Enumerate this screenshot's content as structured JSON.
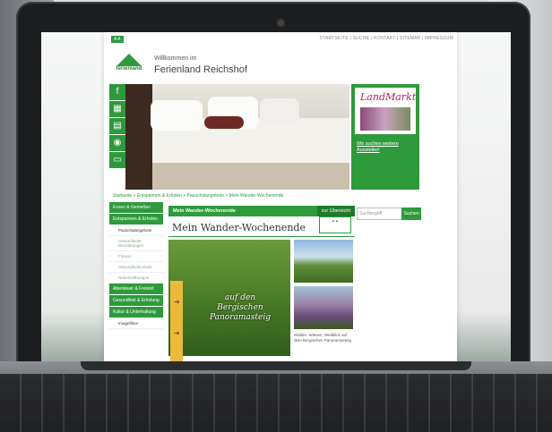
{
  "toplinks": {
    "fontsize_label": "A A",
    "links": "STARTSEITE | SUCHE | KONTAKT | SITEMAP | IMPRESSUM"
  },
  "header": {
    "logo_text": "ferienland",
    "welcome": "Willkommen im",
    "title": "Ferienland Reichshof"
  },
  "side_icons": [
    "facebook-icon",
    "calendar-icon",
    "document-icon",
    "camera-icon",
    "monitor-icon"
  ],
  "ad": {
    "title": "LandMarkt",
    "link": "Wir suchen weitere Aussteller!"
  },
  "breadcrumb": "Startseite > Entspannen & Erholen > Pauschalangebote > Mein Wander-Wochenende",
  "leftnav": {
    "main1": "Essen & Genießen",
    "main2": "Entspannen & Erholen",
    "sub1": "Pauschalangebote",
    "sub2": "Gesundheits- Wanderungen",
    "sub3": "Fitness",
    "sub4": "Gesundheitsurlaub",
    "sub5": "Naturheiltherapie",
    "main3": "Abenteuer & Freizeit",
    "main4": "Gesundheit & Erholung",
    "main5": "Kultur & Unterhaltung",
    "sub6": "Imagefilme"
  },
  "content": {
    "bar_title": "Mein Wander-Wochenende",
    "back_link": "zur Übersicht",
    "title": "Mein Wander-Wochenende",
    "script_line1": "auf den",
    "script_line2": "Bergischen",
    "script_line3": "Panoramasteig",
    "thumb_caption": "Wälder, Wiesen, Weitblick auf dem Bergischen Panoramasteig"
  },
  "search": {
    "placeholder": "Suchbegriff",
    "button": "Suchen"
  },
  "colors": {
    "brand_green": "#2e9a3c",
    "accent_pink": "#b3245e"
  }
}
